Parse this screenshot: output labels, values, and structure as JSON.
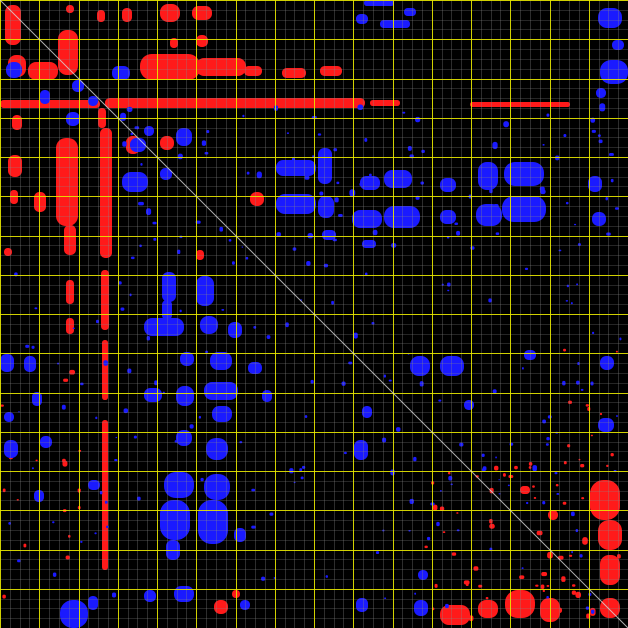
{
  "view": {
    "type": "contact-map",
    "background": "#000000",
    "colors": {
      "minor_grid": "#8a8a8a",
      "major_grid": "#e8e800",
      "diagonal": "#d8d8d8",
      "red": "#ff1a1a",
      "blue": "#1a1aff"
    },
    "grid": {
      "minor_divisions": 64,
      "major_every": 4
    }
  }
}
